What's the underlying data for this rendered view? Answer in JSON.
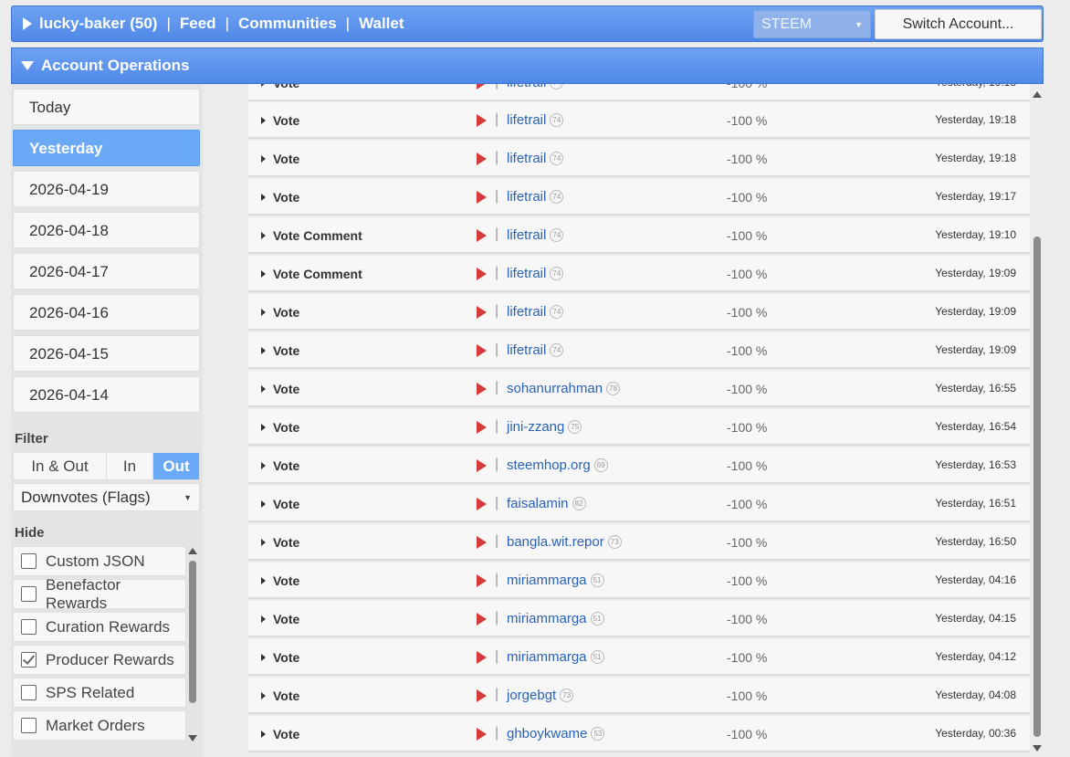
{
  "topbar": {
    "account": "lucky-baker (50)",
    "nav": [
      "Feed",
      "Communities",
      "Wallet"
    ],
    "separator": "|",
    "chain": "STEEM",
    "switch_label": "Switch Account..."
  },
  "ops_header": {
    "title": "Account Operations"
  },
  "sidebar": {
    "days": [
      {
        "label": "Today",
        "active": false
      },
      {
        "label": "Yesterday",
        "active": true
      },
      {
        "label": "2026-04-19",
        "active": false
      },
      {
        "label": "2026-04-18",
        "active": false
      },
      {
        "label": "2026-04-17",
        "active": false
      },
      {
        "label": "2026-04-16",
        "active": false
      },
      {
        "label": "2026-04-15",
        "active": false
      },
      {
        "label": "2026-04-14",
        "active": false
      }
    ],
    "filter_label": "Filter",
    "direction": [
      {
        "label": "In & Out",
        "active": false
      },
      {
        "label": "In",
        "active": false
      },
      {
        "label": "Out",
        "active": true
      }
    ],
    "type_filter": "Downvotes (Flags)",
    "hide_label": "Hide",
    "hide_items": [
      {
        "label": "Custom JSON",
        "checked": false
      },
      {
        "label": "Benefactor Rewards",
        "checked": false
      },
      {
        "label": "Curation Rewards",
        "checked": false
      },
      {
        "label": "Producer Rewards",
        "checked": true
      },
      {
        "label": "SPS Related",
        "checked": false
      },
      {
        "label": "Market Orders",
        "checked": false
      }
    ]
  },
  "operations": [
    {
      "op": "Vote",
      "account": "lifetrail",
      "rep": "74",
      "percent": "-100 %",
      "time": "Yesterday, 19:18"
    },
    {
      "op": "Vote",
      "account": "lifetrail",
      "rep": "74",
      "percent": "-100 %",
      "time": "Yesterday, 19:18"
    },
    {
      "op": "Vote",
      "account": "lifetrail",
      "rep": "74",
      "percent": "-100 %",
      "time": "Yesterday, 19:17"
    },
    {
      "op": "Vote Comment",
      "account": "lifetrail",
      "rep": "74",
      "percent": "-100 %",
      "time": "Yesterday, 19:10"
    },
    {
      "op": "Vote Comment",
      "account": "lifetrail",
      "rep": "74",
      "percent": "-100 %",
      "time": "Yesterday, 19:09"
    },
    {
      "op": "Vote",
      "account": "lifetrail",
      "rep": "74",
      "percent": "-100 %",
      "time": "Yesterday, 19:09"
    },
    {
      "op": "Vote",
      "account": "lifetrail",
      "rep": "74",
      "percent": "-100 %",
      "time": "Yesterday, 19:09"
    },
    {
      "op": "Vote",
      "account": "sohanurrahman",
      "rep": "78",
      "percent": "-100 %",
      "time": "Yesterday, 16:55"
    },
    {
      "op": "Vote",
      "account": "jini-zzang",
      "rep": "75",
      "percent": "-100 %",
      "time": "Yesterday, 16:54"
    },
    {
      "op": "Vote",
      "account": "steemhop.org",
      "rep": "69",
      "percent": "-100 %",
      "time": "Yesterday, 16:53"
    },
    {
      "op": "Vote",
      "account": "faisalamin",
      "rep": "82",
      "percent": "-100 %",
      "time": "Yesterday, 16:51"
    },
    {
      "op": "Vote",
      "account": "bangla.wit.repor",
      "rep": "73",
      "percent": "-100 %",
      "time": "Yesterday, 16:50"
    },
    {
      "op": "Vote",
      "account": "miriammarga",
      "rep": "51",
      "percent": "-100 %",
      "time": "Yesterday, 04:16"
    },
    {
      "op": "Vote",
      "account": "miriammarga",
      "rep": "51",
      "percent": "-100 %",
      "time": "Yesterday, 04:15"
    },
    {
      "op": "Vote",
      "account": "miriammarga",
      "rep": "51",
      "percent": "-100 %",
      "time": "Yesterday, 04:12"
    },
    {
      "op": "Vote",
      "account": "jorgebgt",
      "rep": "73",
      "percent": "-100 %",
      "time": "Yesterday, 04:08"
    },
    {
      "op": "Vote",
      "account": "ghboykwame",
      "rep": "53",
      "percent": "-100 %",
      "time": "Yesterday, 00:36"
    }
  ]
}
